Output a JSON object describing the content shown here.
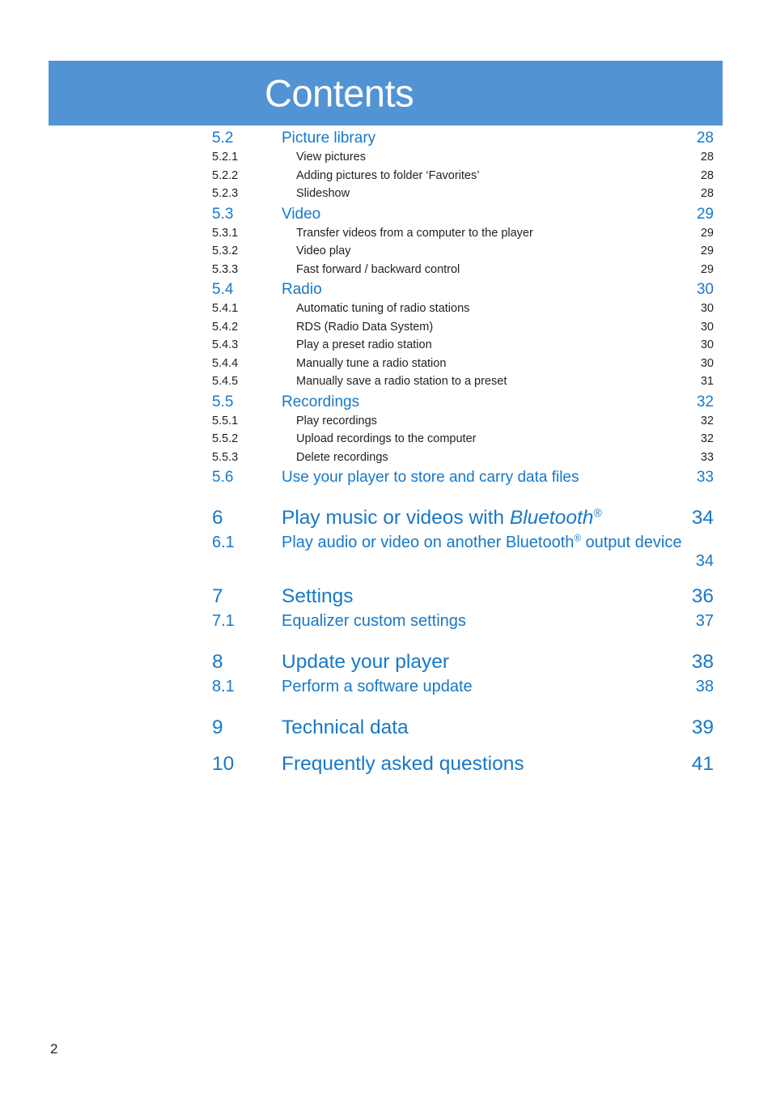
{
  "header": {
    "title": "Contents",
    "band_color": "#5293d4",
    "title_color": "#ffffff"
  },
  "colors": {
    "accent_blue": "#1878c8",
    "body_dark": "#231f20",
    "band": "#5293d4"
  },
  "footer": {
    "page_number": "2"
  },
  "toc": {
    "entries": [
      {
        "level": "section",
        "number": "5.2",
        "title": "Picture library",
        "page": "28"
      },
      {
        "level": "sub",
        "number": "5.2.1",
        "title": "View pictures",
        "page": "28"
      },
      {
        "level": "sub",
        "number": "5.2.2",
        "title": "Adding pictures to folder ‘Favorites’",
        "page": "28"
      },
      {
        "level": "sub",
        "number": "5.2.3",
        "title": "Slideshow",
        "page": "28"
      },
      {
        "level": "section",
        "number": "5.3",
        "title": "Video",
        "page": "29"
      },
      {
        "level": "sub",
        "number": "5.3.1",
        "title": "Transfer videos from a computer to the player",
        "page": "29"
      },
      {
        "level": "sub",
        "number": "5.3.2",
        "title": "Video play",
        "page": "29"
      },
      {
        "level": "sub",
        "number": "5.3.3",
        "title": "Fast forward / backward control",
        "page": "29"
      },
      {
        "level": "section",
        "number": "5.4",
        "title": "Radio",
        "page": "30"
      },
      {
        "level": "sub",
        "number": "5.4.1",
        "title": "Automatic tuning of radio stations",
        "page": "30"
      },
      {
        "level": "sub",
        "number": "5.4.2",
        "title": "RDS (Radio Data System)",
        "page": "30"
      },
      {
        "level": "sub",
        "number": "5.4.3",
        "title": "Play a preset radio station",
        "page": "30"
      },
      {
        "level": "sub",
        "number": "5.4.4",
        "title": "Manually tune a radio station",
        "page": "30"
      },
      {
        "level": "sub",
        "number": "5.4.5",
        "title": "Manually save a radio station to a preset",
        "page": "31"
      },
      {
        "level": "section",
        "number": "5.5",
        "title": "Recordings",
        "page": "32"
      },
      {
        "level": "sub",
        "number": "5.5.1",
        "title": "Play recordings",
        "page": "32"
      },
      {
        "level": "sub",
        "number": "5.5.2",
        "title": "Upload recordings to the computer",
        "page": "32"
      },
      {
        "level": "sub",
        "number": "5.5.3",
        "title": "Delete recordings",
        "page": "33"
      },
      {
        "level": "section",
        "number": "5.6",
        "title": "Use your player to store and carry data files",
        "page": "33"
      },
      {
        "level": "chapter",
        "number": "6",
        "title": "Play music or videos with Bluetooth®",
        "page": "34"
      },
      {
        "level": "chapsub",
        "number": "6.1",
        "title": "Play audio or video on another Bluetooth® output device",
        "page": "34"
      },
      {
        "level": "chapter",
        "number": "7",
        "title": "Settings",
        "page": "36"
      },
      {
        "level": "chapsub",
        "number": "7.1",
        "title": "Equalizer custom settings",
        "page": "37"
      },
      {
        "level": "chapter",
        "number": "8",
        "title": "Update your player",
        "page": "38"
      },
      {
        "level": "chapsub",
        "number": "8.1",
        "title": "Perform a software update",
        "page": "38"
      },
      {
        "level": "chapter",
        "number": "9",
        "title": "Technical data",
        "page": "39"
      },
      {
        "level": "chapter",
        "number": "10",
        "title": "Frequently asked questions",
        "page": "41"
      }
    ],
    "chapter6": {
      "number": "6",
      "title_prefix": "Play music or videos with ",
      "title_italic": "Bluetooth",
      "title_reg": "®",
      "page": "34"
    },
    "section61": {
      "number": "6.1",
      "title_prefix": "Play audio or video on another Bluetooth",
      "title_reg": "®",
      "title_suffix": " output device",
      "page": "34"
    }
  }
}
